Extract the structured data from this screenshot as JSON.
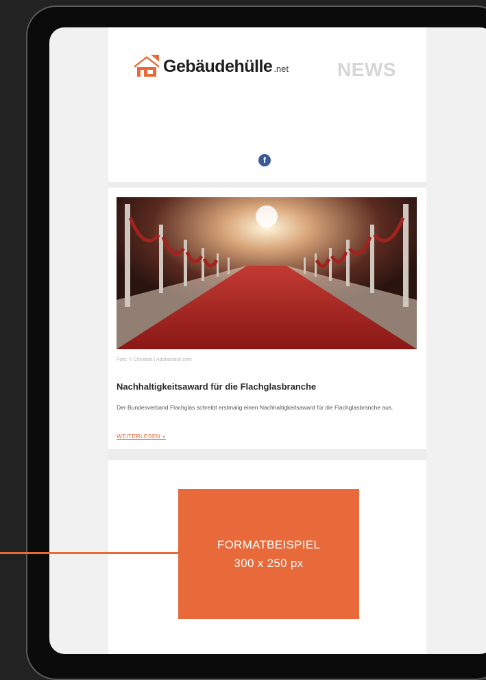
{
  "header": {
    "logo_text": "Gebäudehülle",
    "logo_suffix": ".net",
    "news_label": "NEWS",
    "social_icon": "facebook-icon"
  },
  "article": {
    "photo_credit": "Foto: © Christian | Adobestock.com",
    "title": "Nachhaltigkeitsaward für die Flachglasbranche",
    "excerpt": "Der Bundesverband Flachglas schreibt erstmalig einen Nachhaltigkeitsaward für die Flachglasbranche aus.",
    "read_more": "WEITERLESEN »"
  },
  "ad": {
    "line1": "FORMATBEISPIEL",
    "line2": "300 x 250 px"
  },
  "colors": {
    "accent": "#e8693a",
    "logo_text": "#1f1f1f",
    "news_label": "#d6d6d6",
    "facebook": "#3b5998",
    "background": "#222222"
  }
}
